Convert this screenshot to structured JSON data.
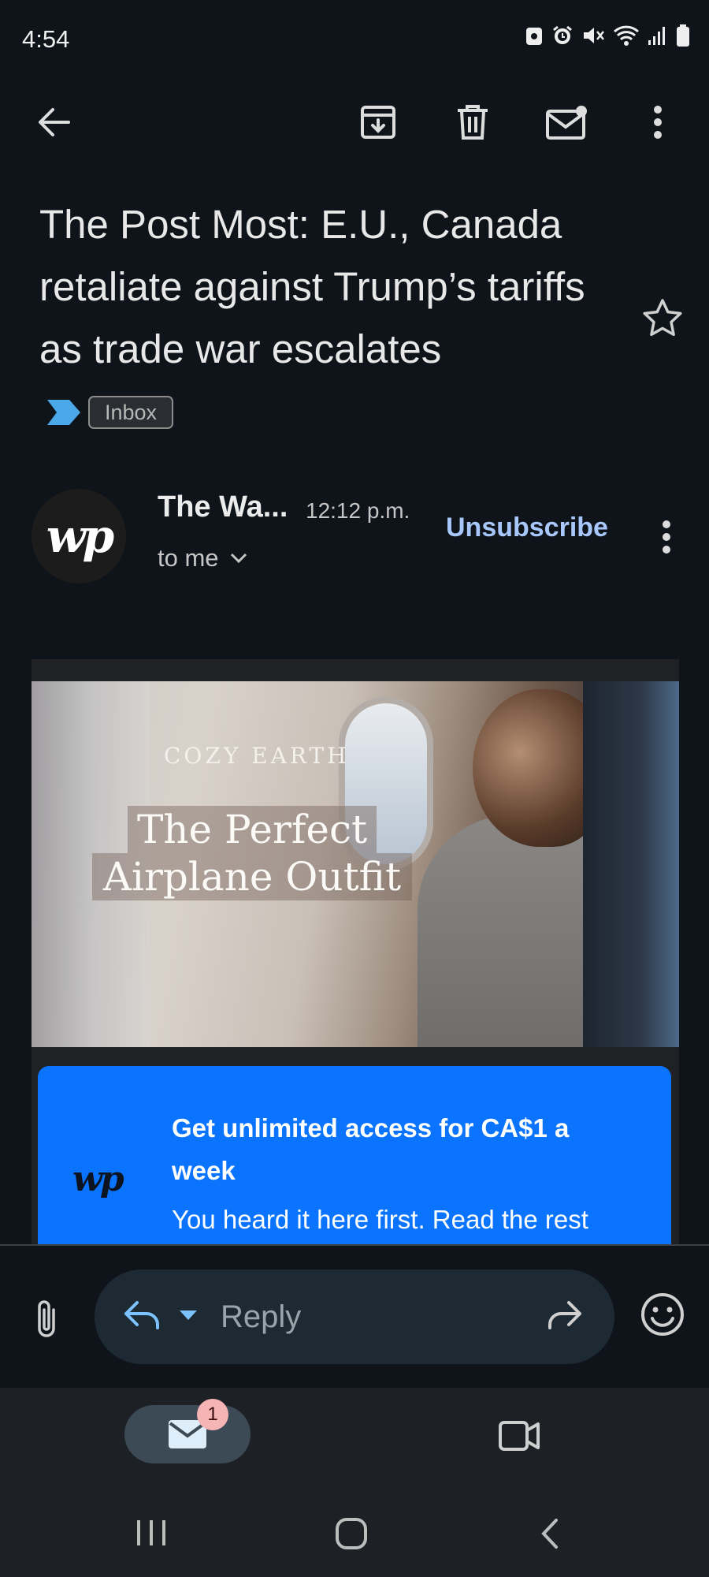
{
  "status": {
    "time": "4:54",
    "icons": [
      "lock-screen-icon",
      "alarm-icon",
      "mute-icon",
      "wifi-icon",
      "signal-icon",
      "battery-icon"
    ]
  },
  "toolbar": {
    "icons": [
      "back-arrow-icon",
      "archive-icon",
      "delete-icon",
      "mark-unread-icon",
      "more-vert-icon"
    ]
  },
  "email": {
    "subject": "The Post Most: E.U., Canada retaliate against Trump’s tariffs as trade war escalates",
    "label_chip": "Inbox",
    "sender_name": "The Wa...",
    "sender_avatar_text": "wp",
    "time": "12:12 p.m.",
    "recipient": "to me",
    "unsubscribe": "Unsubscribe"
  },
  "ad": {
    "brand": "COZY EARTH",
    "headline_line1": "The Perfect",
    "headline_line2": "Airplane Outfit"
  },
  "promo": {
    "logo": "wp",
    "title": "Get unlimited access for CA$1 a week",
    "text": "You heard it here first. Read the rest",
    "color": "#0a74ff"
  },
  "reply": {
    "placeholder": "Reply"
  },
  "bottom_nav": {
    "mail_badge": "1",
    "tabs": [
      "mail-icon",
      "video-icon"
    ]
  },
  "colors": {
    "background": "#0f141a",
    "accent_link": "#a8c7fa",
    "important_marker": "#4aa8e8"
  }
}
